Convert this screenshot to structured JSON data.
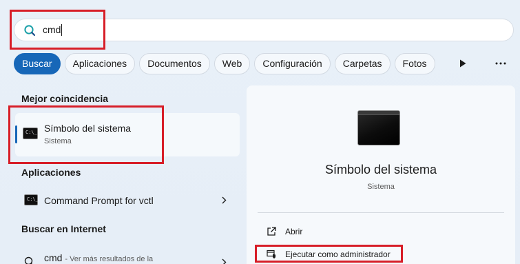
{
  "search": {
    "query": "cmd"
  },
  "filters": [
    {
      "label": "Buscar",
      "active": true
    },
    {
      "label": "Aplicaciones",
      "active": false
    },
    {
      "label": "Documentos",
      "active": false
    },
    {
      "label": "Web",
      "active": false
    },
    {
      "label": "Configuración",
      "active": false
    },
    {
      "label": "Carpetas",
      "active": false
    },
    {
      "label": "Fotos",
      "active": false
    }
  ],
  "sections": {
    "best_match": "Mejor coincidencia",
    "apps": "Aplicaciones",
    "web": "Buscar en Internet"
  },
  "best_match": {
    "title": "Símbolo del sistema",
    "subtitle": "Sistema"
  },
  "apps": [
    {
      "label": "Command Prompt for vctl"
    }
  ],
  "web_results": [
    {
      "label": "cmd",
      "sub": "- Ver más resultados de la"
    }
  ],
  "detail": {
    "title": "Símbolo del sistema",
    "subtitle": "Sistema",
    "actions": [
      {
        "label": "Abrir",
        "icon": "open-external-icon"
      },
      {
        "label": "Ejecutar como administrador",
        "icon": "shield-admin-icon"
      }
    ]
  },
  "colors": {
    "accent": "#1767b8",
    "highlight": "#d71e28"
  },
  "terminal_icon_text": "C:\\_"
}
